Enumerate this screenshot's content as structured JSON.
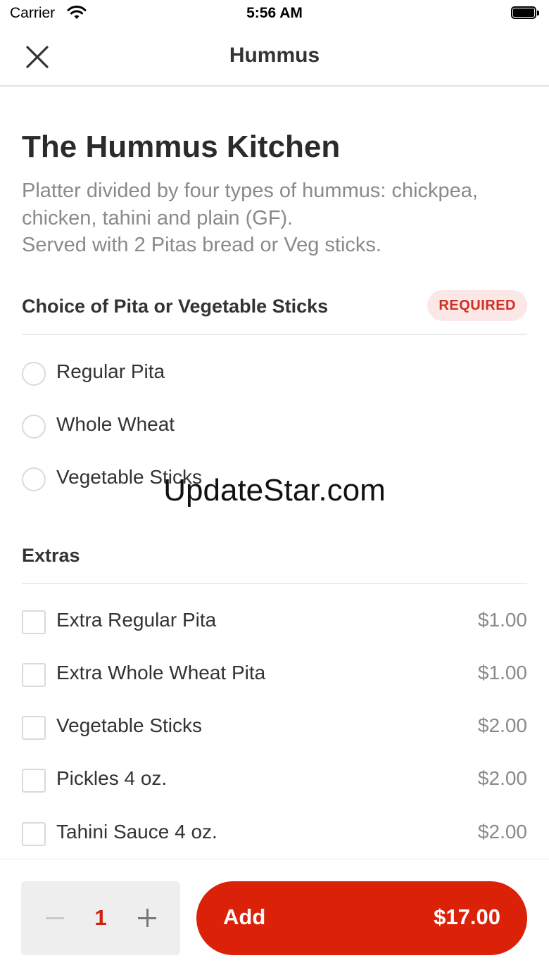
{
  "status_bar": {
    "carrier": "Carrier",
    "time": "5:56 AM",
    "icons": [
      "wifi-icon",
      "battery-icon"
    ]
  },
  "nav": {
    "title": "Hummus",
    "close_icon": "close-icon"
  },
  "item": {
    "title": "The Hummus Kitchen",
    "description": "Platter divided by four types of hummus: chickpea, chicken, tahini and plain (GF).\nServed with 2 Pitas bread or Veg sticks."
  },
  "choice_section": {
    "title": "Choice of Pita or Vegetable Sticks",
    "badge": "REQUIRED",
    "options": [
      {
        "label": "Regular Pita"
      },
      {
        "label": "Whole Wheat"
      },
      {
        "label": "Vegetable Sticks"
      }
    ]
  },
  "extras_section": {
    "title": "Extras",
    "options": [
      {
        "label": "Extra Regular Pita",
        "price": "$1.00"
      },
      {
        "label": "Extra Whole Wheat Pita",
        "price": "$1.00"
      },
      {
        "label": "Vegetable Sticks",
        "price": "$2.00"
      },
      {
        "label": "Pickles 4 oz.",
        "price": "$2.00"
      },
      {
        "label": "Tahini Sauce 4 oz.",
        "price": "$2.00"
      }
    ]
  },
  "watermark": "UpdateStar.com",
  "bottom_bar": {
    "quantity": "1",
    "add_label": "Add",
    "total": "$17.00"
  },
  "colors": {
    "accent": "#dc2109",
    "badge_bg": "#fce7e7",
    "badge_text": "#d02f23",
    "price_text": "#8a8a8a"
  }
}
